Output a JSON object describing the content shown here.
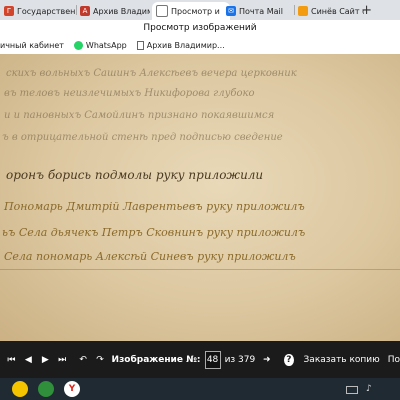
{
  "browser": {
    "tabs": [
      {
        "label": "Государственн",
        "active": false,
        "favicon": "state-archive-icon",
        "color": "#d2452b"
      },
      {
        "label": "Архив Владими",
        "active": false,
        "favicon": "archive-icon",
        "color": "#c0392b"
      },
      {
        "label": "Просмотр и",
        "active": true,
        "favicon": "document-icon",
        "color": "#6a6a6a"
      },
      {
        "label": "Почта Mail",
        "active": false,
        "favicon": "mail-icon",
        "color": "#1a73e8"
      },
      {
        "label": "Синёв Сайт се",
        "active": false,
        "favicon": "site-icon",
        "color": "#f39c12"
      }
    ],
    "page_title": "Просмотр изображений",
    "bookmarks": [
      {
        "label": "ичный кабинет",
        "icon": ""
      },
      {
        "label": "WhatsApp",
        "icon": "whatsapp-icon"
      },
      {
        "label": "Архив Владимир...",
        "icon": "document-icon"
      }
    ]
  },
  "viewer": {
    "lines": [
      {
        "text": "скихъ вольныхъ Сашинъ  Алексѣевъ вечера церковник",
        "style": "faint"
      },
      {
        "text": "въ теловъ неизлечимыхъ Никифорова глубоко",
        "style": "faint"
      },
      {
        "text": "и и пановныхъ Самойлинъ   признано покаявшимся",
        "style": "faint"
      },
      {
        "text": "ъ в отрицательной  стенѣ    пред подписью   сведение",
        "style": "faint"
      },
      {
        "text": "оронъ борись  подмолы      руку приложили",
        "style": "dark"
      },
      {
        "text": "Пономарь Дмитрій  Лаврентьевъ  руку приложилъ",
        "style": "gold"
      },
      {
        "text": "ьъ Села дьячекъ  Петръ Сковнинъ  руку приложилъ",
        "style": "gold"
      },
      {
        "text": "Села   пономарь   Алексѣй   Синевъ   руку приложилъ",
        "style": "gold"
      }
    ]
  },
  "controls": {
    "image_label": "Изображение №:",
    "page_number": "48",
    "total_label": "из 379",
    "order_copy": "Заказать копию",
    "cut_label": "По"
  },
  "taskbar": {
    "items": [
      {
        "icon": "app-icon-yellow",
        "color": "#f5c400"
      },
      {
        "icon": "app-icon-green",
        "color": "#2f8f3a"
      },
      {
        "icon": "yandex-browser-icon",
        "color": "#e2231a"
      }
    ]
  }
}
